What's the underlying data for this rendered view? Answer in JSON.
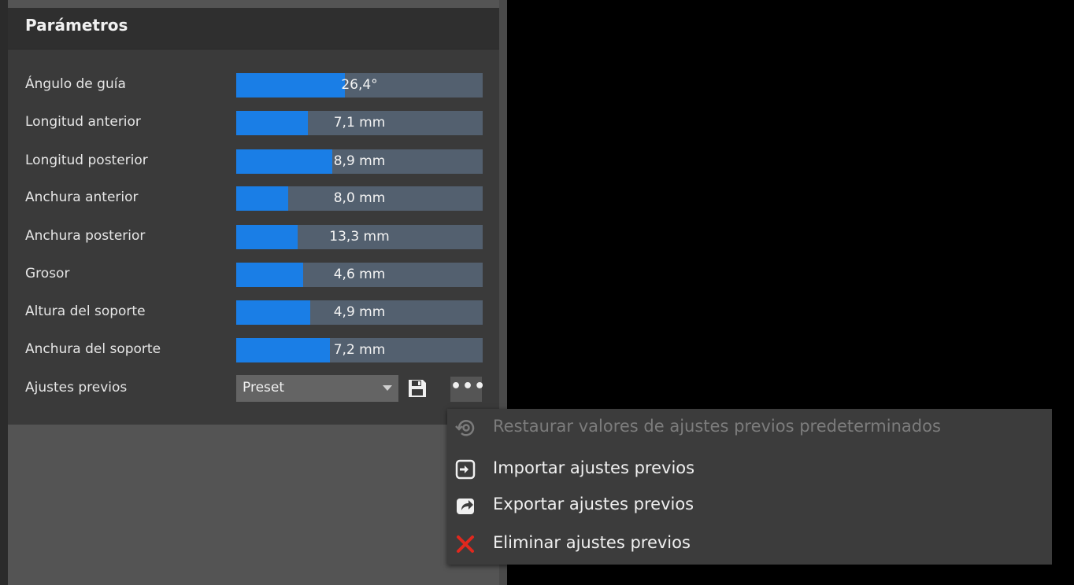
{
  "panel": {
    "title": "Parámetros",
    "parameters": [
      {
        "label": "Ángulo de guía",
        "value": "26,4°",
        "fill": 0.44
      },
      {
        "label": "Longitud anterior",
        "value": "7,1 mm",
        "fill": 0.29
      },
      {
        "label": "Longitud posterior",
        "value": "8,9 mm",
        "fill": 0.39
      },
      {
        "label": "Anchura anterior",
        "value": "8,0 mm",
        "fill": 0.21
      },
      {
        "label": "Anchura posterior",
        "value": "13,3 mm",
        "fill": 0.25
      },
      {
        "label": "Grosor",
        "value": "4,6 mm",
        "fill": 0.27
      },
      {
        "label": "Altura del soporte",
        "value": "4,9 mm",
        "fill": 0.3
      },
      {
        "label": "Anchura del soporte",
        "value": "7,2 mm",
        "fill": 0.38
      }
    ],
    "presets": {
      "label": "Ajustes previos",
      "selected": "Preset",
      "more": "•••"
    }
  },
  "menu": {
    "items": [
      {
        "label": "Restaurar valores de ajustes previos predeterminados",
        "icon": "restore-icon",
        "enabled": false
      },
      {
        "label": "Importar ajustes previos",
        "icon": "import-icon",
        "enabled": true
      },
      {
        "label": "Exportar ajustes previos",
        "icon": "export-icon",
        "enabled": true
      },
      {
        "label": "Eliminar ajustes previos",
        "icon": "delete-icon",
        "enabled": true
      }
    ]
  },
  "colors": {
    "accent": "#1a7ee6",
    "track": "#53606f",
    "delete": "#e0281e"
  }
}
